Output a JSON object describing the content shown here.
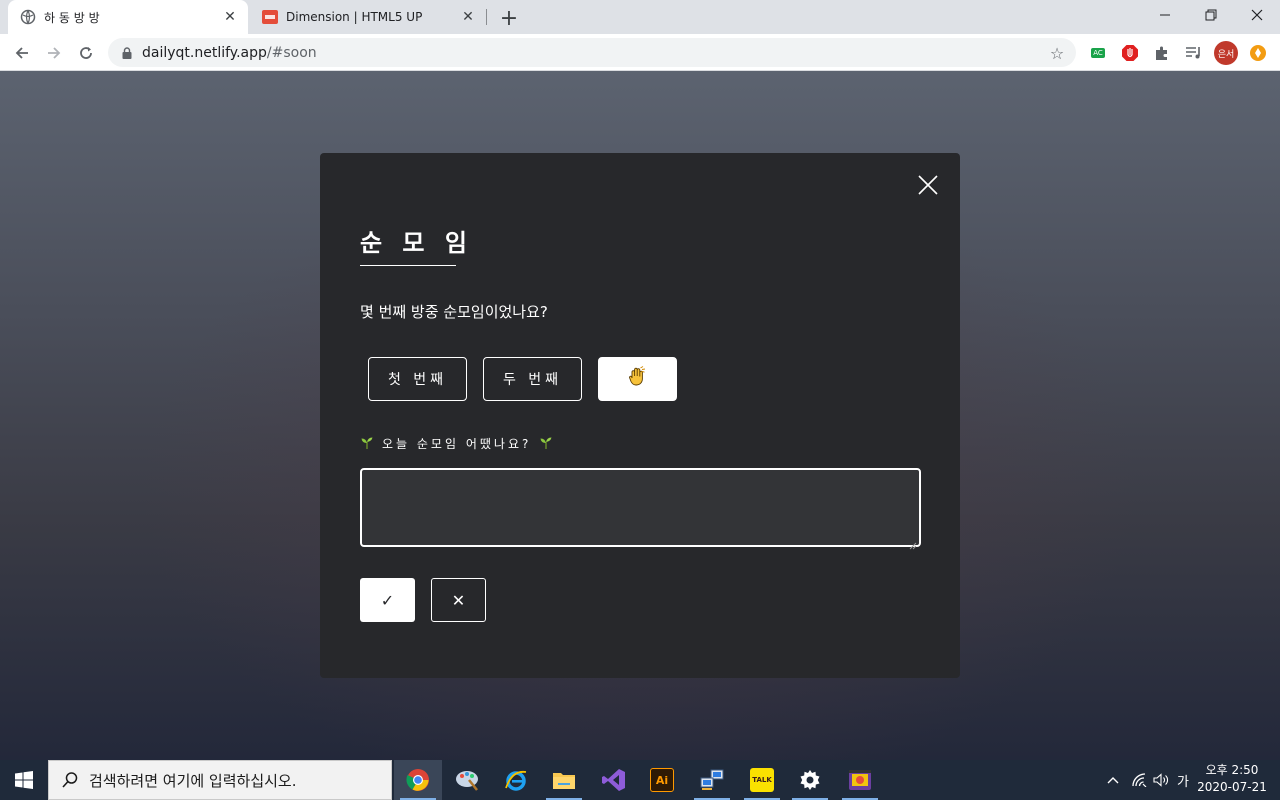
{
  "browser": {
    "tabs": [
      {
        "title": "하 동 방 방",
        "active": true,
        "favicon": "globe-icon"
      },
      {
        "title": "Dimension | HTML5 UP",
        "active": false,
        "favicon": "html5up-favicon"
      }
    ],
    "url_host": "dailyqt.netlify.app",
    "url_path": "/#soon",
    "profile_initials": "은서",
    "ext_ac_label": "AC"
  },
  "modal": {
    "title": "순 모 임",
    "question": "몇 번째 방중 순모임이었나요?",
    "choices": [
      {
        "label": "첫 번째",
        "selected": false
      },
      {
        "label": "두 번째",
        "selected": false
      },
      {
        "label": "",
        "icon": "hand-emoji-icon",
        "selected": true
      }
    ],
    "feedback_label": "오늘 순모임 어땠나요?",
    "feedback_value": "",
    "confirm_label": "✓",
    "cancel_label": "✕"
  },
  "taskbar": {
    "search_placeholder": "검색하려면 여기에 입력하십시오.",
    "ime_label": "가",
    "time": "오후 2:50",
    "date": "2020-07-21",
    "kakao_label": "TALK",
    "ai_label": "Ai"
  },
  "colors": {
    "modal_bg": "#27282b",
    "accent_white": "#ffffff",
    "taskbar_bg": "#1f2a3a"
  }
}
